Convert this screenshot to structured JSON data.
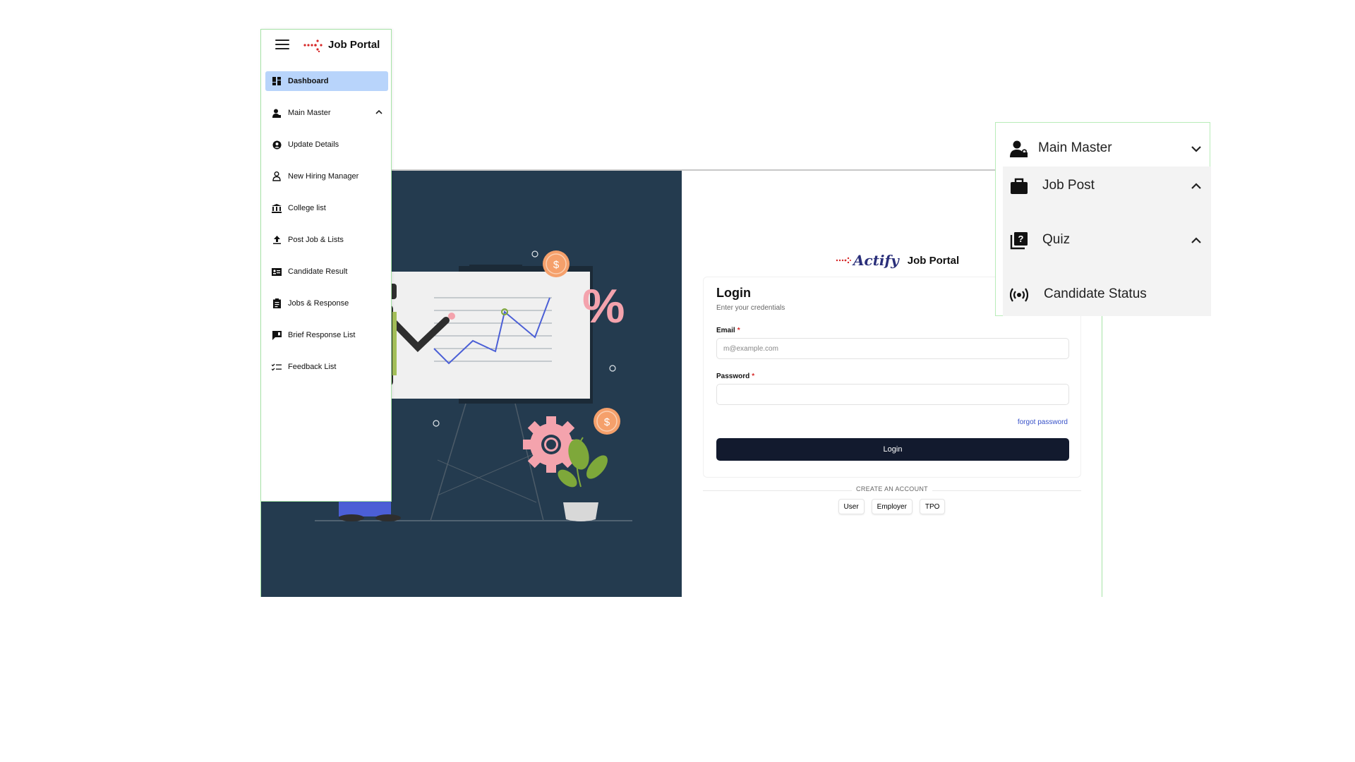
{
  "sidebar": {
    "brand": "Job Portal",
    "items": [
      {
        "label": "Dashboard",
        "icon": "dashboard-icon"
      },
      {
        "label": "Main Master",
        "icon": "user-icon"
      },
      {
        "label": "Update Details",
        "icon": "account-circle-icon"
      },
      {
        "label": "New Hiring Manager",
        "icon": "person-lock-icon"
      },
      {
        "label": "College list",
        "icon": "institution-icon"
      },
      {
        "label": "Post Job & Lists",
        "icon": "upload-icon"
      },
      {
        "label": "Candidate Result",
        "icon": "result-card-icon"
      },
      {
        "label": "Jobs & Response",
        "icon": "clipboard-icon"
      },
      {
        "label": "Brief Response List",
        "icon": "bookmark-icon"
      },
      {
        "label": "Feedback List",
        "icon": "checklist-icon"
      }
    ]
  },
  "login": {
    "brand_logo": "Actify",
    "brand_title": "Job Portal",
    "title": "Login",
    "subtitle": "Enter your credentials",
    "email_label": "Email",
    "email_placeholder": "m@example.com",
    "password_label": "Password",
    "password_value": "",
    "required_mark": "*",
    "forgot": "forgot password",
    "submit": "Login",
    "create_account": "CREATE AN ACCOUNT",
    "account_types": [
      "User",
      "Employer",
      "TPO"
    ]
  },
  "floating_menu": {
    "items": [
      {
        "label": "Main Master",
        "icon": "user-lock-icon",
        "chevron": "down"
      },
      {
        "label": "Job Post",
        "icon": "briefcase-icon",
        "chevron": "up"
      },
      {
        "label": "Quiz",
        "icon": "quiz-icon",
        "chevron": "up"
      },
      {
        "label": "Candidate Status",
        "icon": "broadcast-icon",
        "chevron": ""
      }
    ]
  },
  "hero": {
    "coin_symbol": "$",
    "percent_symbol": "%"
  },
  "colors": {
    "hero_bg": "#243b4f",
    "active_nav": "#b8d4fb",
    "login_button": "#121a2e",
    "coin": "#f5a06b",
    "gear": "#f4a3ad",
    "chart_line": "#4b5fd6",
    "link": "#3751c8"
  }
}
